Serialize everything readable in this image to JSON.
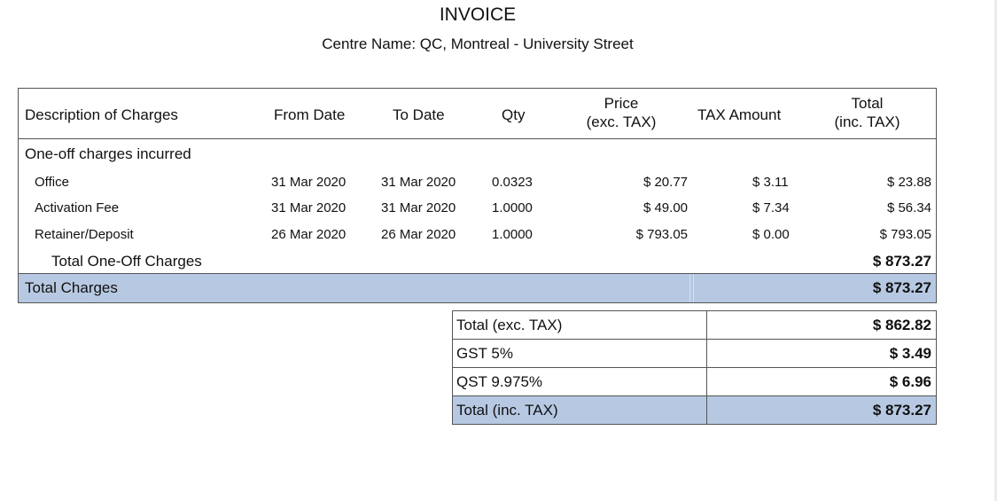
{
  "invoice": {
    "title": "INVOICE",
    "centre": "Centre Name: QC, Montreal - University Street"
  },
  "charges_table": {
    "headers": {
      "description": "Description of Charges",
      "from_date": "From Date",
      "to_date": "To Date",
      "qty": "Qty",
      "price_line1": "Price",
      "price_line2": "(exc. TAX)",
      "tax_amount": "TAX Amount",
      "total_line1": "Total",
      "total_line2": "(inc. TAX)"
    },
    "section_label": "One-off charges incurred",
    "rows": [
      {
        "description": "Office",
        "from": "31 Mar 2020",
        "to": "31 Mar 2020",
        "qty": "0.0323",
        "price": "$ 20.77",
        "tax": "$ 3.11",
        "total": "$ 23.88"
      },
      {
        "description": "Activation Fee",
        "from": "31 Mar 2020",
        "to": "31 Mar 2020",
        "qty": "1.0000",
        "price": "$ 49.00",
        "tax": "$ 7.34",
        "total": "$ 56.34"
      },
      {
        "description": "Retainer/Deposit",
        "from": "26 Mar 2020",
        "to": "26 Mar 2020",
        "qty": "1.0000",
        "price": "$ 793.05",
        "tax": "$ 0.00",
        "total": "$ 793.05"
      }
    ],
    "subtotal_label": "Total One-Off Charges",
    "subtotal_amount": "$ 873.27",
    "total_label": "Total Charges",
    "total_amount": "$ 873.27"
  },
  "summary_table": {
    "rows": [
      {
        "label": "Total (exc. TAX)",
        "amount": "$ 862.82"
      },
      {
        "label": "GST 5%",
        "amount": "$ 3.49"
      },
      {
        "label": "QST 9.975%",
        "amount": "$ 6.96"
      },
      {
        "label": "Total (inc. TAX)",
        "amount": "$ 873.27"
      }
    ]
  },
  "colors": {
    "total_band": "#b7c9e2",
    "border": "#555555"
  }
}
